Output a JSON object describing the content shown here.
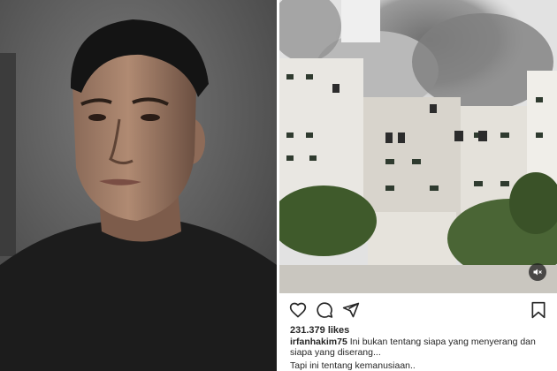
{
  "post": {
    "likes": "231.379 likes",
    "username": "irfanhakim75",
    "caption_line1": "Ini bukan tentang siapa yang menyerang dan siapa yang diserang...",
    "caption_line2": "Tapi ini tentang kemanusiaan.."
  },
  "icons": {
    "like": "heart-icon",
    "comment": "comment-icon",
    "share": "send-icon",
    "save": "bookmark-icon",
    "mute": "muted-speaker-icon"
  },
  "colors": {
    "text": "#262626",
    "background": "#ffffff"
  }
}
